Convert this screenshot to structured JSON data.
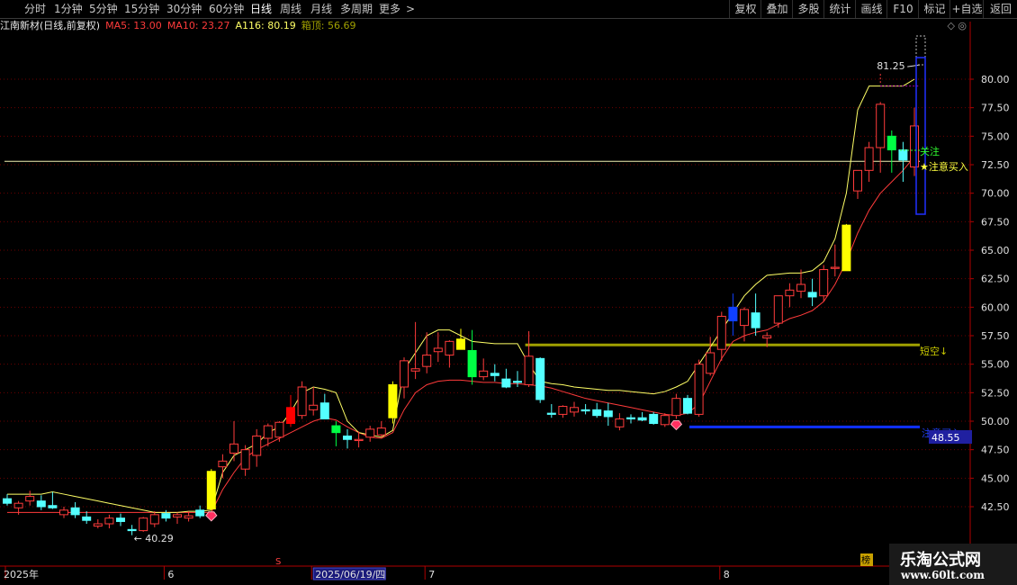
{
  "toolbar": {
    "left_tabs": [
      "分时",
      "1分钟",
      "5分钟",
      "15分钟",
      "30分钟",
      "60分钟",
      "日线",
      "周线",
      "月线",
      "多周期",
      "更多"
    ],
    "active_tab": "日线",
    "more_arrow": ">",
    "right_tabs": [
      "复权",
      "叠加",
      "多股",
      "统计",
      "画线",
      "F10",
      "标记",
      "+自选",
      "返回"
    ]
  },
  "infobar": {
    "stock": "江南新材(日线,前复权)",
    "indicators": [
      {
        "text": "MA5: 13.00",
        "color": "#ff3b3b"
      },
      {
        "text": "MA10: 23.27",
        "color": "#ff3b3b"
      },
      {
        "text": "A116: 80.19",
        "color": "#ffff66"
      },
      {
        "text": "箱顶: 56.69",
        "color": "#a0a000"
      }
    ],
    "corner_icons": "◇ ◎"
  },
  "axis": {
    "y_ticks": [
      "80.00",
      "77.50",
      "75.00",
      "72.50",
      "70.00",
      "67.50",
      "65.00",
      "62.50",
      "60.00",
      "57.50",
      "55.00",
      "52.50",
      "50.00",
      "47.50",
      "45.00",
      "42.50"
    ],
    "x_labels": [
      {
        "text": "2025年",
        "i": 0
      },
      {
        "text": "6",
        "i": 14
      },
      {
        "text": "2025/06/19/四",
        "i": 27
      },
      {
        "text": "7",
        "i": 37
      },
      {
        "text": "8",
        "i": 63
      }
    ],
    "s_marker": "S",
    "bang_marker": "榜",
    "price_tag": "48.55"
  },
  "annotations": {
    "high_label": "81.25",
    "low_label": "40.29",
    "guanzhu": "关注",
    "buy_star": "★注意买入",
    "short_label": "短空↓",
    "buy_blue": "注意买入"
  },
  "colors": {
    "up": "#ff3b3b",
    "down": "#54ffff",
    "ma_yellow": "#ffff66",
    "box": "#a0a000",
    "blue": "#1030ff",
    "grid": "#6b0000",
    "axis_text": "#e0e0e0"
  },
  "chart_data": {
    "type": "candlestick",
    "ylim": [
      40.0,
      82.5
    ],
    "candles": [
      [
        43.2,
        43.6,
        42.6,
        42.8
      ],
      [
        42.4,
        43.0,
        41.8,
        42.8
      ],
      [
        43.0,
        43.9,
        42.6,
        43.4
      ],
      [
        43.0,
        43.5,
        42.2,
        42.5
      ],
      [
        42.6,
        43.8,
        42.3,
        42.4
      ],
      [
        41.8,
        42.5,
        41.5,
        42.2
      ],
      [
        42.4,
        42.9,
        41.5,
        41.8
      ],
      [
        41.6,
        42.1,
        41.0,
        41.3
      ],
      [
        40.8,
        41.4,
        40.6,
        41.0
      ],
      [
        41.0,
        41.8,
        40.6,
        41.5
      ],
      [
        41.5,
        41.9,
        40.8,
        41.2
      ],
      [
        40.5,
        40.9,
        40.0,
        40.4
      ],
      [
        40.4,
        41.6,
        40.3,
        41.5
      ],
      [
        41.0,
        42.1,
        40.7,
        41.8
      ],
      [
        41.9,
        42.2,
        41.2,
        41.5
      ],
      [
        41.6,
        42.0,
        41.0,
        41.8
      ],
      [
        41.5,
        42.1,
        41.2,
        41.7
      ],
      [
        42.2,
        42.6,
        41.5,
        41.7
      ],
      [
        42.3,
        45.8,
        42.2,
        45.6
      ],
      [
        46.0,
        47.1,
        45.0,
        46.5
      ],
      [
        47.2,
        50.0,
        46.5,
        48.0
      ],
      [
        45.8,
        47.9,
        45.2,
        47.5
      ],
      [
        47.0,
        49.3,
        46.0,
        48.7
      ],
      [
        48.5,
        49.8,
        47.8,
        49.6
      ],
      [
        48.6,
        50.0,
        48.2,
        49.9
      ],
      [
        49.8,
        52.3,
        49.5,
        51.2
      ],
      [
        50.5,
        53.5,
        50.2,
        53.0
      ],
      [
        51.0,
        53.0,
        50.5,
        51.4
      ],
      [
        51.6,
        52.4,
        50.4,
        50.2
      ],
      [
        49.6,
        50.0,
        47.8,
        49.0
      ],
      [
        48.7,
        49.3,
        47.6,
        48.4
      ],
      [
        48.3,
        49.1,
        47.7,
        48.4
      ],
      [
        48.6,
        49.6,
        48.2,
        49.3
      ],
      [
        48.8,
        50.0,
        48.6,
        49.4
      ],
      [
        50.3,
        53.5,
        49.8,
        53.2
      ],
      [
        53.0,
        55.6,
        52.0,
        55.3
      ],
      [
        54.4,
        58.7,
        53.7,
        54.6
      ],
      [
        54.8,
        57.8,
        54.2,
        55.8
      ],
      [
        56.1,
        57.8,
        55.2,
        56.4
      ],
      [
        55.8,
        57.1,
        54.7,
        57.0
      ],
      [
        57.2,
        58.1,
        56.5,
        56.3
      ],
      [
        56.2,
        58.0,
        53.2,
        53.9
      ],
      [
        53.9,
        55.5,
        53.6,
        54.4
      ],
      [
        54.2,
        55.0,
        53.5,
        54.0
      ],
      [
        53.7,
        54.6,
        52.9,
        53.0
      ],
      [
        53.5,
        54.4,
        53.0,
        53.4
      ],
      [
        53.2,
        57.9,
        53.0,
        55.7
      ],
      [
        55.5,
        55.6,
        51.6,
        51.9
      ],
      [
        50.7,
        51.5,
        50.3,
        50.6
      ],
      [
        50.6,
        51.4,
        50.3,
        51.3
      ],
      [
        50.8,
        51.7,
        50.4,
        51.2
      ],
      [
        51.0,
        51.5,
        50.6,
        50.9
      ],
      [
        51.0,
        51.6,
        50.3,
        50.5
      ],
      [
        50.9,
        51.6,
        49.6,
        50.4
      ],
      [
        49.5,
        50.7,
        49.2,
        50.2
      ],
      [
        50.3,
        50.6,
        49.8,
        50.2
      ],
      [
        50.3,
        50.8,
        50.0,
        50.1
      ],
      [
        50.6,
        50.8,
        49.7,
        49.8
      ],
      [
        49.7,
        50.7,
        49.5,
        50.5
      ],
      [
        50.5,
        52.4,
        50.2,
        52.0
      ],
      [
        52.0,
        52.3,
        50.6,
        50.7
      ],
      [
        50.6,
        55.4,
        50.4,
        55.0
      ],
      [
        54.2,
        57.4,
        54.0,
        56.0
      ],
      [
        56.3,
        59.6,
        55.3,
        59.2
      ],
      [
        60.0,
        61.2,
        57.5,
        58.8
      ],
      [
        58.4,
        60.0,
        57.0,
        59.8
      ],
      [
        59.5,
        61.2,
        57.5,
        58.2
      ],
      [
        57.3,
        57.8,
        56.5,
        57.5
      ],
      [
        58.6,
        61.0,
        58.2,
        61.0
      ],
      [
        61.0,
        62.1,
        60.0,
        61.5
      ],
      [
        61.4,
        63.3,
        60.8,
        62.0
      ],
      [
        61.3,
        62.5,
        60.1,
        60.9
      ],
      [
        61.0,
        63.7,
        60.5,
        63.3
      ],
      [
        63.4,
        65.5,
        62.7,
        63.5
      ],
      [
        63.2,
        67.3,
        63.2,
        67.2
      ],
      [
        70.2,
        71.0,
        69.5,
        72.0
      ],
      [
        72.0,
        74.5,
        71.0,
        74.0
      ],
      [
        74.0,
        78.0,
        71.8,
        77.8
      ],
      [
        75.0,
        75.5,
        71.8,
        73.8
      ],
      [
        73.8,
        74.5,
        71.0,
        72.9
      ],
      [
        72.3,
        77.5,
        71.5,
        75.9
      ]
    ],
    "ma_yellow": [
      43.6,
      43.6,
      43.6,
      43.6,
      43.8,
      43.6,
      43.4,
      43.2,
      43.0,
      42.8,
      42.6,
      42.4,
      42.2,
      42.0,
      42.0,
      42.0,
      42.1,
      42.1,
      42.2,
      45.5,
      47.0,
      47.5,
      48.0,
      49.0,
      49.5,
      50.8,
      52.5,
      53.0,
      52.8,
      52.5,
      50.0,
      49.0,
      48.8,
      48.6,
      49.2,
      54.5,
      56.0,
      57.5,
      58.0,
      58.0,
      57.5,
      57.0,
      56.9,
      56.8,
      56.8,
      56.8,
      55.0,
      53.5,
      53.3,
      53.2,
      53.0,
      52.9,
      52.8,
      52.7,
      52.7,
      52.6,
      52.5,
      52.4,
      52.6,
      53.0,
      53.5,
      55.0,
      56.5,
      58.0,
      59.5,
      61.0,
      62.0,
      62.8,
      62.9,
      63.0,
      63.0,
      63.2,
      64.0,
      66.0,
      70.0,
      77.3,
      79.4,
      79.4,
      79.4,
      79.4,
      80.0
    ],
    "ma_red": [
      42.0,
      42.0,
      42.0,
      42.0,
      42.0,
      42.0,
      42.0,
      42.0,
      42.0,
      42.0,
      42.0,
      42.0,
      42.0,
      42.0,
      42.0,
      42.0,
      42.0,
      42.0,
      42.0,
      44.0,
      45.5,
      46.8,
      47.5,
      48.0,
      48.5,
      49.0,
      49.5,
      50.0,
      50.3,
      50.1,
      49.5,
      49.0,
      48.6,
      48.5,
      49.0,
      51.0,
      52.5,
      53.2,
      53.5,
      53.6,
      53.6,
      53.5,
      53.4,
      53.4,
      53.3,
      53.3,
      53.2,
      53.1,
      52.9,
      52.6,
      52.3,
      52.0,
      51.8,
      51.6,
      51.4,
      51.2,
      51.0,
      50.8,
      50.6,
      50.5,
      50.7,
      51.5,
      53.5,
      55.5,
      57.0,
      57.5,
      57.8,
      58.0,
      58.5,
      59.0,
      59.3,
      59.7,
      60.5,
      62.0,
      64.0,
      66.5,
      68.5,
      70.0,
      71.0,
      72.0,
      73.2
    ],
    "box_top": 56.69,
    "hline_white": 72.8,
    "blue_buy_line": 49.5,
    "yellow_bars": [
      18,
      34,
      40,
      74
    ],
    "red_bar": 25,
    "green_bars": [
      29,
      41,
      78
    ],
    "blue_bar": 64,
    "high_marker": {
      "i": 77,
      "value": 81.25
    },
    "low_marker": {
      "i": 11,
      "value": 40.29
    },
    "diamonds": [
      18,
      59
    ]
  }
}
